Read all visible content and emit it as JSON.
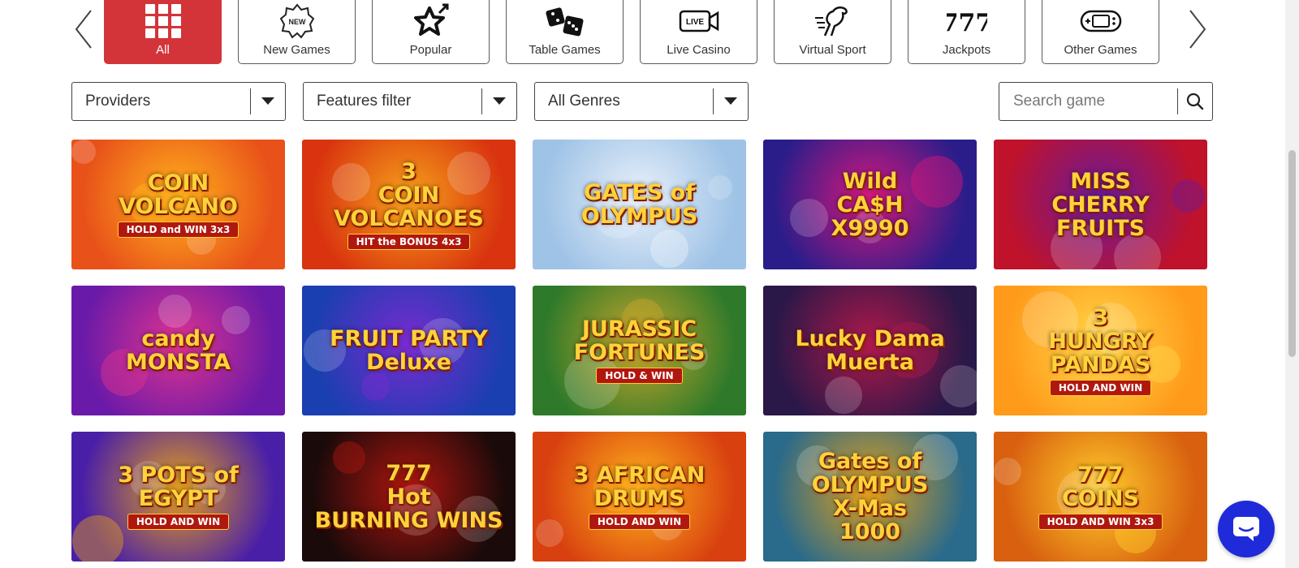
{
  "categories": [
    {
      "label": "All",
      "icon": "grid-icon",
      "active": true
    },
    {
      "label": "New Games",
      "icon": "new-badge-icon"
    },
    {
      "label": "Popular",
      "icon": "star-icon"
    },
    {
      "label": "Table Games",
      "icon": "dice-icon"
    },
    {
      "label": "Live Casino",
      "icon": "live-camera-icon"
    },
    {
      "label": "Virtual Sport",
      "icon": "horse-icon"
    },
    {
      "label": "Jackpots",
      "icon": "sevens-icon"
    },
    {
      "label": "Other Games",
      "icon": "gamepad-icon"
    }
  ],
  "category_icon_text": {
    "new": "NEW",
    "live": "LIVE",
    "sevens": "777"
  },
  "filters": {
    "providers": "Providers",
    "features": "Features filter",
    "genres": "All Genres"
  },
  "search": {
    "placeholder": "Search game"
  },
  "games": [
    {
      "title": "COIN\nVOLCANO",
      "sub": "HOLD and WIN 3x3",
      "bg": "#e8511a",
      "bg2": "#ffb21c"
    },
    {
      "title": "3\nCOIN\nVOLCANOES",
      "sub": "HIT the BONUS 4x3",
      "bg": "#d9340f",
      "bg2": "#f6a11a"
    },
    {
      "title": "GATES of OLYMPUS",
      "sub": "",
      "bg": "#9fc3e6",
      "bg2": "#e9f1fb"
    },
    {
      "title": "Wild\nCA$H\nX9990",
      "sub": "",
      "bg": "#2a1d8a",
      "bg2": "#d7187c"
    },
    {
      "title": "MISS\nCHERRY\nFRUITS",
      "sub": "",
      "bg": "#c0122b",
      "bg2": "#6a1a9a"
    },
    {
      "title": "candy\nMONSTA",
      "sub": "",
      "bg": "#6a1aa8",
      "bg2": "#e0338f"
    },
    {
      "title": "FRUIT PARTY\nDeluxe",
      "sub": "",
      "bg": "#1a3fb0",
      "bg2": "#7a2ad0"
    },
    {
      "title": "JURASSIC\nFORTUNES",
      "sub": "HOLD & WIN",
      "bg": "#2f7a2a",
      "bg2": "#c9a62a"
    },
    {
      "title": "Lucky Dama\nMuerta",
      "sub": "",
      "bg": "#2a1848",
      "bg2": "#b0184a"
    },
    {
      "title": "3\nHUNGRY\nPANDAS",
      "sub": "HOLD AND WIN",
      "bg": "#ff9a1a",
      "bg2": "#ffd84a"
    },
    {
      "title": "3 POTS of EGYPT",
      "sub": "HOLD AND WIN",
      "bg": "#4a1fa8",
      "bg2": "#e5a01a"
    },
    {
      "title": "777\nHot\nBURNING WINS",
      "sub": "",
      "bg": "#1a0a0a",
      "bg2": "#b0160f"
    },
    {
      "title": "3 AFRICAN\nDRUMS",
      "sub": "HOLD AND WIN",
      "bg": "#d8400f",
      "bg2": "#ffb21c"
    },
    {
      "title": "Gates of\nOLYMPUS\nX-Mas\n1000",
      "sub": "",
      "bg": "#2a6a8a",
      "bg2": "#e4a01a"
    },
    {
      "title": "777\nCOINS",
      "sub": "HOLD AND WIN 3x3",
      "bg": "#d8600f",
      "bg2": "#ffcc2a"
    }
  ],
  "colors": {
    "accent": "#d3343a",
    "chat": "#1f2bd8"
  }
}
